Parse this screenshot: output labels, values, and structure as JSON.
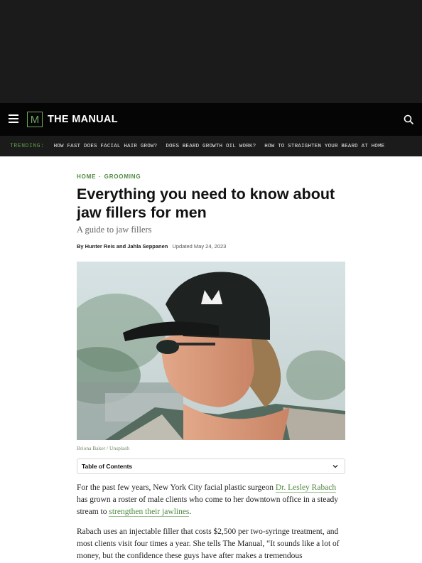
{
  "header": {
    "logo_letter": "M",
    "logo_text": "THE MANUAL"
  },
  "trending": {
    "label": "TRENDING:",
    "links": [
      "HOW FAST DOES FACIAL HAIR GROW?",
      "DOES BEARD GROWTH OIL WORK?",
      "HOW TO STRAIGHTEN YOUR BEARD AT HOME"
    ]
  },
  "article": {
    "breadcrumb": [
      "HOME",
      "GROOMING"
    ],
    "breadcrumb_separator": "·",
    "title": "Everything you need to know about jaw fillers for men",
    "subtitle": "A guide to jaw fillers",
    "byline": {
      "authors": "By Hunter Reis and Jahla Seppanen",
      "updated": "Updated May 24, 2023"
    },
    "image_credit": "Briona Baker / Unsplash",
    "toc_label": "Table of Contents",
    "paragraph1": {
      "text_before": "For the past few years, New York City facial plastic surgeon ",
      "link1": "Dr. Lesley Rabach",
      "text_middle": " has grown a roster of male clients who come to her downtown office in a steady stream to ",
      "link2": "strengthen their jawlines",
      "text_after": "."
    },
    "paragraph2": "Rabach uses an injectable filler that costs $2,500 per two-syringe treatment, and most clients visit four times a year. She tells The Manual, “It sounds like a lot of money, but the confidence these guys have after makes a tremendous"
  },
  "colors": {
    "accent_green": "#4d8a3f",
    "header_bg": "#050505",
    "trending_bg": "#1a1b1a"
  },
  "icons": [
    "menu-icon",
    "search-icon",
    "chevron-down-icon"
  ]
}
